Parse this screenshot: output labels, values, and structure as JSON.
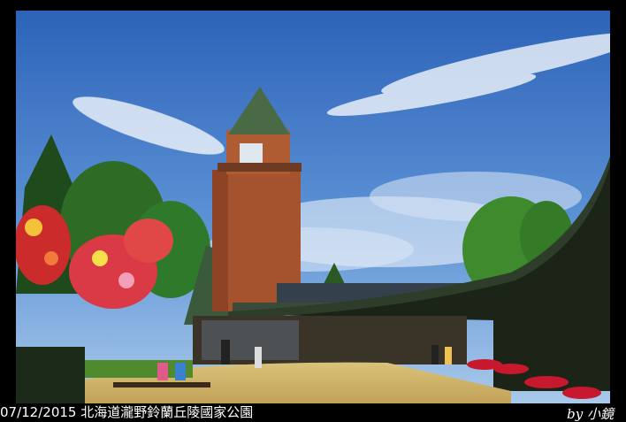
{
  "caption": "07/12/2015 北海道瀧野鈴蘭丘陵國家公園",
  "signature": "by 小鏡"
}
